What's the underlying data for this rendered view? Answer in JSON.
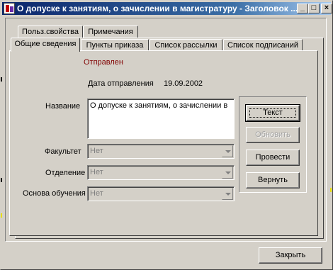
{
  "window": {
    "title": "О допуске к занятиям, о зачислении в магистратуру - Заголовок ...",
    "minimize_glyph": "_",
    "maximize_glyph": "□",
    "close_glyph": "×"
  },
  "tabs_back": [
    {
      "label": "Польз.свойства"
    },
    {
      "label": "Примечания"
    }
  ],
  "tabs_front": [
    {
      "label": "Общие сведения",
      "active": true
    },
    {
      "label": "Пункты приказа"
    },
    {
      "label": "Список рассылки"
    },
    {
      "label": "Список подписаний"
    }
  ],
  "general": {
    "status": "Отправлен",
    "send_date_label": "Дата отправления",
    "send_date_value": "19.09.2002",
    "name_label": "Название",
    "name_value": "О допуске к занятиям, о зачислении в",
    "faculty_label": "Факультет",
    "faculty_value": "Нет",
    "department_label": "Отделение",
    "department_value": "Нет",
    "study_basis_label": "Основа обучения",
    "study_basis_value": "Нет"
  },
  "side_buttons": {
    "text": "Текст",
    "update": "Обновить",
    "process": "Провести",
    "return": "Вернуть"
  },
  "footer": {
    "close": "Закрыть"
  },
  "colors": {
    "face": "#d4d0c8",
    "status_text": "#800000",
    "titlebar_start": "#0a246a",
    "titlebar_end": "#a6caf0"
  }
}
